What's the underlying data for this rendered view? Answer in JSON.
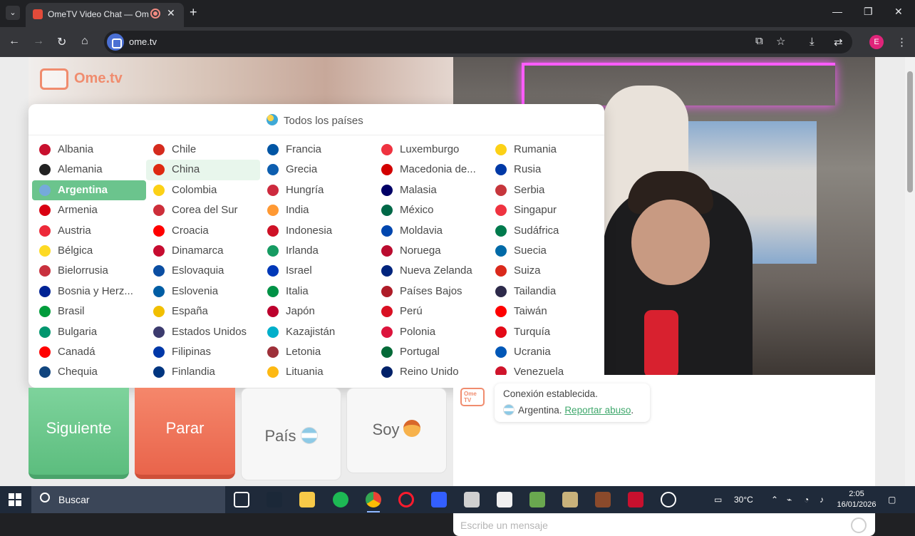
{
  "browser": {
    "tab_title": "OmeTV Video Chat — Ome",
    "url": "ome.tv",
    "profile_initial": "E",
    "new_tab_label": "+",
    "close_label": "✕"
  },
  "site": {
    "logo_text": "Ome.tv",
    "logo_badge": "Ome TV"
  },
  "dropdown": {
    "all_countries": "Todos los países",
    "columns": [
      [
        {
          "name": "Albania",
          "color": "#c8102e"
        },
        {
          "name": "Alemania",
          "color": "#222222"
        },
        {
          "name": "Argentina",
          "color": "#75aadb"
        },
        {
          "name": "Armenia",
          "color": "#d90012"
        },
        {
          "name": "Austria",
          "color": "#ed2939"
        },
        {
          "name": "Bélgica",
          "color": "#fdda24"
        },
        {
          "name": "Bielorrusia",
          "color": "#c8313e"
        },
        {
          "name": "Bosnia y Herz...",
          "color": "#002395"
        },
        {
          "name": "Brasil",
          "color": "#009c3b"
        },
        {
          "name": "Bulgaria",
          "color": "#00966e"
        },
        {
          "name": "Canadá",
          "color": "#ff0000"
        },
        {
          "name": "Chequia",
          "color": "#11457e"
        }
      ],
      [
        {
          "name": "Chile",
          "color": "#d52b1e"
        },
        {
          "name": "China",
          "color": "#de2910"
        },
        {
          "name": "Colombia",
          "color": "#fcd116"
        },
        {
          "name": "Corea del Sur",
          "color": "#cd2e3a"
        },
        {
          "name": "Croacia",
          "color": "#ff0000"
        },
        {
          "name": "Dinamarca",
          "color": "#c60c30"
        },
        {
          "name": "Eslovaquia",
          "color": "#0b4ea2"
        },
        {
          "name": "Eslovenia",
          "color": "#005da4"
        },
        {
          "name": "España",
          "color": "#f1bf00"
        },
        {
          "name": "Estados Unidos",
          "color": "#3c3b6e"
        },
        {
          "name": "Filipinas",
          "color": "#0038a8"
        },
        {
          "name": "Finlandia",
          "color": "#003580"
        }
      ],
      [
        {
          "name": "Francia",
          "color": "#0055a4"
        },
        {
          "name": "Grecia",
          "color": "#0d5eaf"
        },
        {
          "name": "Hungría",
          "color": "#cd2a3e"
        },
        {
          "name": "India",
          "color": "#ff9933"
        },
        {
          "name": "Indonesia",
          "color": "#ce1126"
        },
        {
          "name": "Irlanda",
          "color": "#169b62"
        },
        {
          "name": "Israel",
          "color": "#0038b8"
        },
        {
          "name": "Italia",
          "color": "#009246"
        },
        {
          "name": "Japón",
          "color": "#bc002d"
        },
        {
          "name": "Kazajistán",
          "color": "#00afca"
        },
        {
          "name": "Letonia",
          "color": "#9e3039"
        },
        {
          "name": "Lituania",
          "color": "#fdb913"
        }
      ],
      [
        {
          "name": "Luxemburgo",
          "color": "#ef3340"
        },
        {
          "name": "Macedonia de...",
          "color": "#d20000"
        },
        {
          "name": "Malasia",
          "color": "#010066"
        },
        {
          "name": "México",
          "color": "#006847"
        },
        {
          "name": "Moldavia",
          "color": "#0046ae"
        },
        {
          "name": "Noruega",
          "color": "#ba0c2f"
        },
        {
          "name": "Nueva Zelanda",
          "color": "#00247d"
        },
        {
          "name": "Países Bajos",
          "color": "#ae1c28"
        },
        {
          "name": "Perú",
          "color": "#d91023"
        },
        {
          "name": "Polonia",
          "color": "#dc143c"
        },
        {
          "name": "Portugal",
          "color": "#046a38"
        },
        {
          "name": "Reino Unido",
          "color": "#012169"
        }
      ],
      [
        {
          "name": "Rumania",
          "color": "#fcd116"
        },
        {
          "name": "Rusia",
          "color": "#0039a6"
        },
        {
          "name": "Serbia",
          "color": "#c6363c"
        },
        {
          "name": "Singapur",
          "color": "#ef3340"
        },
        {
          "name": "Sudáfrica",
          "color": "#007a4d"
        },
        {
          "name": "Suecia",
          "color": "#006aa7"
        },
        {
          "name": "Suiza",
          "color": "#da291c"
        },
        {
          "name": "Tailandia",
          "color": "#2d2a4a"
        },
        {
          "name": "Taiwán",
          "color": "#fe0000"
        },
        {
          "name": "Turquía",
          "color": "#e30a17"
        },
        {
          "name": "Ucrania",
          "color": "#0057b7"
        },
        {
          "name": "Venezuela",
          "color": "#cf142b"
        }
      ]
    ],
    "selected": "Argentina",
    "hovered": "China"
  },
  "buttons": {
    "next": "Siguiente",
    "stop": "Parar",
    "country": "País",
    "soy": "Soy"
  },
  "chat": {
    "status": "Conexión establecida.",
    "country": "Argentina.",
    "report": "Reportar abuso",
    "report_suffix": ".",
    "placeholder": "Escribe un mensaje"
  },
  "taskbar": {
    "search": "Buscar",
    "temperature": "30°C",
    "time": "2:05",
    "date": "16/01/2026"
  }
}
